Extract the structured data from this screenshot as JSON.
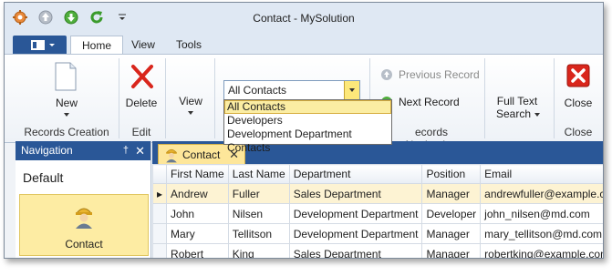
{
  "window": {
    "title": "Contact - MySolution"
  },
  "ribbon_tabs": [
    {
      "label": "Home",
      "active": true
    },
    {
      "label": "View",
      "active": false
    },
    {
      "label": "Tools",
      "active": false
    }
  ],
  "ribbon": {
    "new_label": "New",
    "delete_label": "Delete",
    "view_label": "View",
    "filter": {
      "value": "All Contacts",
      "options": [
        "All Contacts",
        "Developers",
        "Development Department Contacts"
      ]
    },
    "previous_record_label": "Previous Record",
    "next_record_label": "Next Record",
    "full_text_search_label_1": "Full Text",
    "full_text_search_label_2": "Search",
    "close_label": "Close",
    "groups": {
      "records_creation": "Records Creation",
      "edit": "Edit",
      "records_navigation": "ecords Navigation",
      "close": "Close"
    }
  },
  "navigation": {
    "header": "Navigation",
    "group": "Default",
    "item": "Contact"
  },
  "document": {
    "tab_label": "Contact"
  },
  "grid": {
    "columns": [
      "First Name",
      "Last Name",
      "Department",
      "Position",
      "Email"
    ],
    "rows": [
      [
        "Andrew",
        "Fuller",
        "Sales Department",
        "Manager",
        "andrewfuller@example.com"
      ],
      [
        "John",
        "Nilsen",
        "Development Department",
        "Developer",
        "john_nilsen@md.com"
      ],
      [
        "Mary",
        "Tellitson",
        "Development Department",
        "Manager",
        "mary_tellitson@md.com"
      ],
      [
        "Robert",
        "King",
        "Sales Department",
        "Manager",
        "robertking@example.com"
      ]
    ]
  },
  "colors": {
    "accent": "#2a5797",
    "highlight": "#fdeca3",
    "delete": "#d9261c"
  }
}
